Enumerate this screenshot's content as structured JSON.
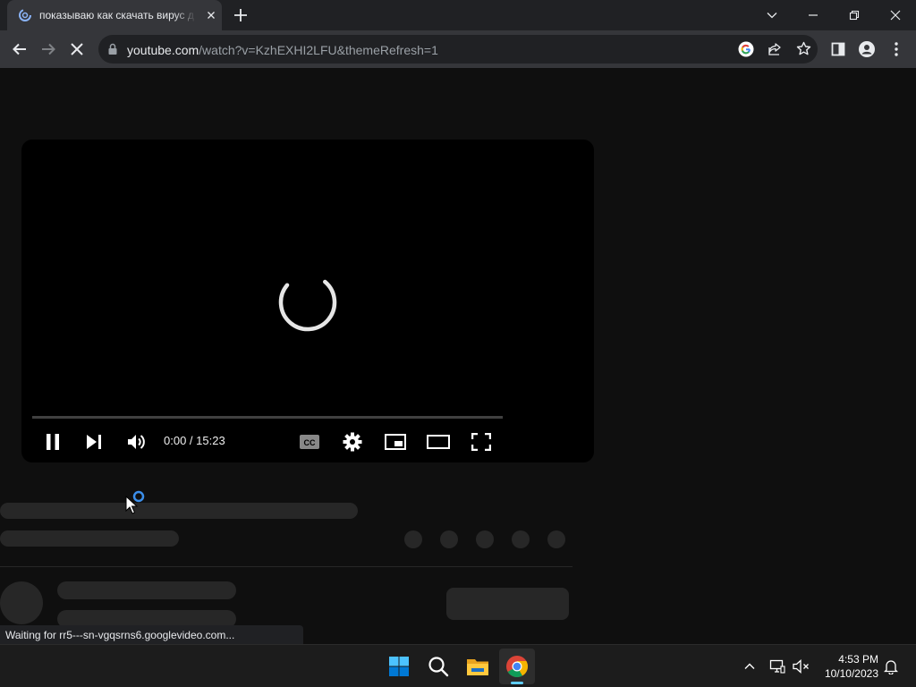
{
  "tab": {
    "title": "показываю как скачать вирус д",
    "favicon": "loading-spinner-icon"
  },
  "window_controls": [
    "chevron-down-icon",
    "minimize-icon",
    "restore-icon",
    "close-icon"
  ],
  "toolbar": {
    "url_host": "youtube.com",
    "url_path": "/watch?v=KzhEXHI2LFU&themeRefresh=1",
    "icons": [
      "back-icon",
      "forward-icon",
      "stop-icon",
      "lock-icon",
      "google-icon",
      "share-icon",
      "star-icon",
      "side-panel-icon",
      "profile-icon",
      "menu-icon"
    ]
  },
  "player": {
    "time": "0:00 / 15:23",
    "progress": 0,
    "state": "loading",
    "controls": [
      "pause-icon",
      "next-icon",
      "volume-icon",
      "captions-icon",
      "settings-icon",
      "miniplayer-icon",
      "theater-icon",
      "fullscreen-icon"
    ]
  },
  "status_bar": {
    "text": "Waiting for rr5---sn-vgqsrns6.googlevideo.com..."
  },
  "taskbar": {
    "apps": [
      "windows-start-icon",
      "search-icon",
      "file-explorer-icon",
      "chrome-icon"
    ],
    "tray": [
      "chevron-up-icon",
      "network-icon",
      "volume-muted-icon",
      "notification-bell-icon"
    ],
    "time": "4:53 PM",
    "date": "10/10/2023"
  },
  "colors": {
    "page_bg": "#0f0f0f",
    "skeleton": "#272727",
    "chrome_frame": "#202124",
    "chrome_toolbar": "#35363a",
    "accent_blue": "#1a73e8"
  }
}
